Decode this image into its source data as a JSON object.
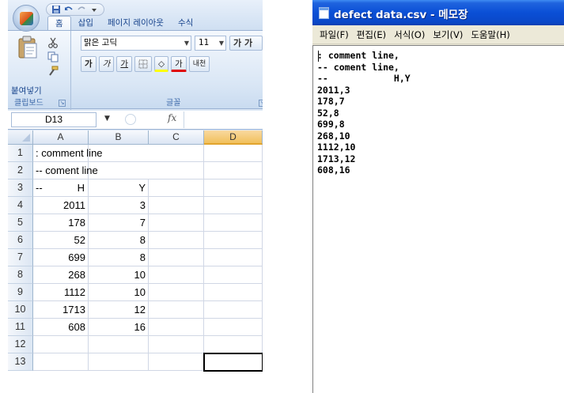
{
  "excel": {
    "tabs": [
      "홈",
      "삽입",
      "페이지 레이아웃",
      "수식"
    ],
    "clipboard": {
      "paste_label": "붙여넣기",
      "group_label": "클립보드"
    },
    "font": {
      "name": "맑은 고딕",
      "size": "11",
      "grow_label": "가 가",
      "bold": "가",
      "italic": "가",
      "underline": "가",
      "fill_glyph": "◇",
      "color_glyph": "가",
      "phonetic_glyph": "내천",
      "group_label": "글꼴"
    },
    "formula_bar": {
      "name_box": "D13",
      "fx": "fx",
      "value": ""
    },
    "columns": [
      "A",
      "B",
      "C",
      "D"
    ],
    "rows": [
      {
        "n": "1",
        "a": ": comment line",
        "b": ""
      },
      {
        "n": "2",
        "a": "-- coment line",
        "b": ""
      },
      {
        "n": "3",
        "a": "--",
        "a_right": "H",
        "b": "Y"
      },
      {
        "n": "4",
        "a": "2011",
        "b": "3"
      },
      {
        "n": "5",
        "a": "178",
        "b": "7"
      },
      {
        "n": "6",
        "a": "52",
        "b": "8"
      },
      {
        "n": "7",
        "a": "699",
        "b": "8"
      },
      {
        "n": "8",
        "a": "268",
        "b": "10"
      },
      {
        "n": "9",
        "a": "1112",
        "b": "10"
      },
      {
        "n": "10",
        "a": "1713",
        "b": "12"
      },
      {
        "n": "11",
        "a": "608",
        "b": "16"
      },
      {
        "n": "12",
        "a": "",
        "b": ""
      },
      {
        "n": "13",
        "a": "",
        "b": ""
      }
    ],
    "selected_column": "D"
  },
  "notepad": {
    "title": "defect data.csv - 메모장",
    "menu": [
      "파일(F)",
      "편집(E)",
      "서식(O)",
      "보기(V)",
      "도움말(H)"
    ],
    "lines": [
      ": comment line,",
      "-- coment line,",
      "--            H,Y",
      "2011,3",
      "178,7",
      "52,8",
      "699,8",
      "268,10",
      "1112,10",
      "1713,12",
      "608,16"
    ]
  }
}
